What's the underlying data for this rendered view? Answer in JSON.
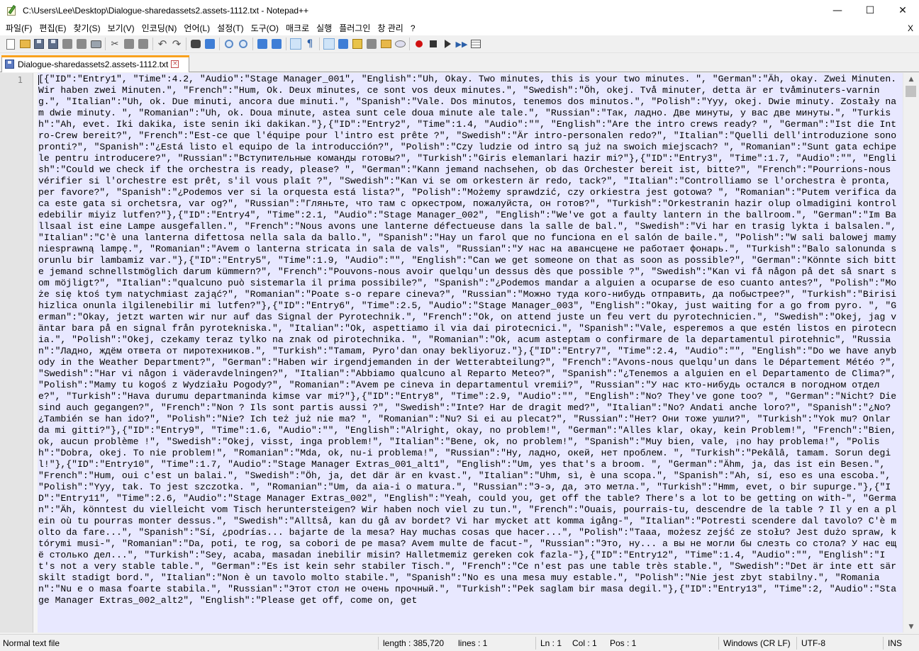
{
  "window": {
    "title": "C:\\Users\\Lee\\Desktop\\Dialogue-sharedassets2.assets-1112.txt - Notepad++",
    "minimize": "—",
    "maximize": "☐",
    "close": "✕"
  },
  "menu": {
    "items": [
      "파일(F)",
      "편집(E)",
      "찾기(S)",
      "보기(V)",
      "인코딩(N)",
      "언어(L)",
      "설정(T)",
      "도구(O)",
      "매크로",
      "실행",
      "플러그인",
      "창 관리",
      "?"
    ],
    "close_doc": "X"
  },
  "toolbar": {
    "icons": [
      "new-file-icon",
      "open-file-icon",
      "save-icon",
      "save-all-icon",
      "close-icon",
      "close-all-icon",
      "print-icon",
      "cut-icon",
      "copy-icon",
      "paste-icon",
      "undo-icon",
      "redo-icon",
      "find-icon",
      "replace-icon",
      "zoom-in-icon",
      "zoom-out-icon",
      "sync-vertical-icon",
      "sync-horizontal-icon",
      "word-wrap-icon",
      "show-all-chars-icon",
      "indent-guide-icon",
      "language-icon",
      "color-icon",
      "doc-map-icon",
      "folder-workspace-icon",
      "monitoring-icon",
      "record-macro-icon",
      "stop-record-icon",
      "play-macro-icon",
      "run-macro-multiple-icon",
      "save-macro-icon"
    ]
  },
  "tab": {
    "label": "Dialogue-sharedassets2.assets-1112.txt",
    "close": "×"
  },
  "editor": {
    "line_number": "1",
    "content": "[{\"ID\":\"Entry1\", \"Time\":4.2, \"Audio\":\"Stage Manager_001\", \"English\":\"Uh, Okay. Two minutes, this is your two minutes. \", \"German\":\"Äh, okay. Zwei Minuten. Wir haben zwei Minuten.\", \"French\":\"Hum, Ok. Deux minutes, ce sont vos deux minutes.\", \"Swedish\":\"Öh, okej. Två minuter, detta är er tvåminuters-varning.\", \"Italian\":\"Uh, ok. Due minuti, ancora due minuti.\", \"Spanish\":\"Vale. Dos minutos, tenemos dos minutos.\", \"Polish\":\"Yyy, okej. Dwie minuty. Zostały nam dwie minuty. \", \"Romanian\":\"Uh, ok. Doua minute, astea sunt cele doua minute ale tale.\", \"Russian\":\"Так, ладно. Две минуты, у вас две минуты.\", \"Turkish\":\"Ah, evet. Iki dakika, iste senin iki dakikan.\"},{\"ID\":\"Entry2\", \"Time\":1.4, \"Audio\":\"\", \"English\":\"Are the intro crews ready? \", \"German\":\"Ist die Intro-Crew bereit?\", \"French\":\"Est-ce que l'équipe pour l'intro est prête ?\", \"Swedish\":\"Är intro-personalen redo?\", \"Italian\":\"Quelli dell'introduzione sono pronti?\", \"Spanish\":\"¿Está listo el equipo de la introducción?\", \"Polish\":\"Czy ludzie od intro są już na swoich miejscach? \", \"Romanian\":\"Sunt gata echipele pentru introducere?\", \"Russian\":\"Вступительные команды готовы?\", \"Turkish\":\"Giris elemanlari hazir mi?\"},{\"ID\":\"Entry3\", \"Time\":1.7, \"Audio\":\"\", \"English\":\"Could we check if the orchestra is ready, please? \", \"German\":\"Kann jemand nachsehen, ob das Orchester bereit ist, bitte?\", \"French\":\"Pourrions-nous vérifier si l'orchestre est prêt, s'il vous plaît ?\", \"Swedish\":\"Kan vi se om orkestern är redo, tack?\", \"Italian\":\"Controlliamo se l'orchestra è pronta, per favore?\", \"Spanish\":\"¿Podemos ver si la orquesta está lista?\", \"Polish\":\"Możemy sprawdzić, czy orkiestra jest gotowa? \", \"Romanian\":\"Putem verifica daca este gata si orchetsra, var og?\", \"Russian\":\"Гляньте, что там с оркестром, пожалуйста, он готов?\", \"Turkish\":\"Orkestranin hazir olup olmadigini kontrol edebilir miyiz lutfen?\"},{\"ID\":\"Entry4\", \"Time\":2.1, \"Audio\":\"Stage Manager_002\", \"English\":\"We've got a faulty lantern in the ballroom.\", \"German\":\"Im Ballsaal ist eine Lampe ausgefallen.\", \"French\":\"Nous avons une lanterne défectueuse dans la salle de bal.\", \"Swedish\":\"Vi har en trasig lykta i balsalen.\", \"Italian\":\"C'è una lanterna difettosa nella sala da ballo.\", \"Spanish\":\"Hay un farol que no funciona en el salón de baile.\", \"Polish\":\"W sali balowej mamy niesprawną lampę.\", \"Romanian\":\"Avem o lanterna stricata in sala de vals\", \"Russian\":\"У нас на авансцене не работает фонарь.\", \"Turkish\":\"Balo salonunda sorunlu bir lambamiz var.\"},{\"ID\":\"Entry5\", \"Time\":1.9, \"Audio\":\"\", \"English\":\"Can we get someone on that as soon as possible?\", \"German\":\"Könnte sich bitte jemand schnellstmöglich darum kümmern?\", \"French\":\"Pouvons-nous avoir quelqu'un dessus dès que possible ?\", \"Swedish\":\"Kan vi få någon på det så snart som möjligt?\", \"Italian\":\"qualcuno può sistemarla il prima possibile?\", \"Spanish\":\"¿Podemos mandar a alguien a ocuparse de eso cuanto antes?\", \"Polish\":\"Może się ktoś tym natychmiast zająć?\", \"Romanian\":\"Poate s-o repare cineva?\", \"Russian\":\"Можно туда кого-нибудь отправить, да побыстрее?\", \"Turkish\":\"Birisi hizlica onunla ilgilenebilir mi lutfen?\"},{\"ID\":\"Entry6\", \"Time\":2.5, \"Audio\":\"Stage Manager_003\", \"English\":\"Okay, just waiting for a go from pyro. \", \"German\":\"Okay, jetzt warten wir nur auf das Signal der Pyrotechnik.\", \"French\":\"Ok, on attend juste un feu vert du pyrotechnicien.\", \"Swedish\":\"Okej, jag väntar bara på en signal från pyrotekniska.\", \"Italian\":\"Ok, aspettiamo il via dai pirotecnici.\", \"Spanish\":\"Vale, esperemos a que estén listos en pirotecnia.\", \"Polish\":\"Okej, czekamy teraz tylko na znak od pirotechnika. \", \"Romanian\":\"Ok, acum asteptam o confirmare de la departamentul pirotehnic\", \"Russian\":\"Ладно, ждём ответа от пиротехников.\", \"Turkish\":\"Tamam, Pyro'dan onay bekliyoruz.\"},{\"ID\":\"Entry7\", \"Time\":2.4, \"Audio\":\"\", \"English\":\"Do we have anybody in the Weather Department?\", \"German\":\"Haben wir irgendjemanden in der Wetterabteilung?\", \"French\":\"Avons-nous quelqu'un dans le Département Météo ?\", \"Swedish\":\"Har vi någon i väderavdelningen?\", \"Italian\":\"Abbiamo qualcuno al Reparto Meteo?\", \"Spanish\":\"¿Tenemos a alguien en el Departamento de Clima?\", \"Polish\":\"Mamy tu kogoś z Wydziału Pogody?\", \"Romanian\":\"Avem pe cineva in departamentul vremii?\", \"Russian\":\"У нас кто-нибудь остался в погодном отделе?\", \"Turkish\":\"Hava durumu departmaninda kimse var mi?\"},{\"ID\":\"Entry8\", \"Time\":2.9, \"Audio\":\"\", \"English\":\"No? They've gone too? \", \"German\":\"Nicht? Die sind auch gegangen?\", \"French\":\"Non ? Ils sont partis aussi ?\", \"Swedish\":\"Inte? Har de dragit med?\", \"Italian\":\"No? Andati anche loro?\", \"Spanish\":\"¿No? ¿También se han ido?\", \"Polish\":\"Nie? Ich też już nie ma? \", \"Romanian\":\"Nu? Si ei au plecat?\", \"Russian\":\"Нет? Они тоже ушли?\", \"Turkish\":\"Yok mu? Onlar da mi gitti?\"},{\"ID\":\"Entry9\", \"Time\":1.6, \"Audio\":\"\", \"English\":\"Alright, okay, no problem!\", \"German\":\"Alles klar, okay, kein Problem!\", \"French\":\"Bien, ok, aucun problème !\", \"Swedish\":\"Okej, visst, inga problem!\", \"Italian\":\"Bene, ok, no problem!\", \"Spanish\":\"Muy bien, vale, ¡no hay problema!\", \"Polish\":\"Dobra, okej. To nie problem!\", \"Romanian\":\"Mda, ok, nu-i problema!\", \"Russian\":\"Ну, ладно, окей, нет проблем. \", \"Turkish\":\"Pekâlâ, tamam. Sorun degil!\"},{\"ID\":\"Entry10\", \"Time\":1.7, \"Audio\":\"Stage Manager Extras_001_alt1\", \"English\":\"Um, yes that's a broom. \", \"German\":\"Ähm, ja, das ist ein Besen.\", \"French\":\"Hum, oui c'est un balai.\", \"Swedish\":\"Öh, ja, det där är en kvast.\", \"Italian\":\"Uhm, sì, è una scopa.\", \"Spanish\":\"Ah, sí, eso es una escoba.\", \"Polish\":\"Yyy, tak. To jest szczotka. \", \"Romanian\":\"Um, da aia-i o matura.\", \"Russian\":\"Э-э, да, это метла.\", \"Turkish\":\"Hmm, evet, o bir supurge.\"},{\"ID\":\"Entry11\", \"Time\":2.6, \"Audio\":\"Stage Manager Extras_002\", \"English\":\"Yeah, could you, get off the table? There's a lot to be getting on with-\", \"German\":\"Äh, könntest du vielleicht vom Tisch heruntersteigen? Wir haben noch viel zu tun.\", \"French\":\"Ouais, pourrais-tu, descendre de la table ? Il y en a plein où tu pourras monter dessus.\", \"Swedish\":\"Alltså, kan du gå av bordet? Vi har mycket att komma igång-\", \"Italian\":\"Potresti scendere dal tavolo? C'è molto da fare...\", \"Spanish\":\"Sí, ¿podrías... bajarte de la mesa? Hay muchas cosas que hacer...\", \"Polish\":\"Taaa, możesz zejść ze stołu? Jest dużo spraw, którymi musi-\", \"Romanian\":\"Da, poti, te rog, sa cobori de pe masa? Avem multe de facut-\", \"Russian\":\"Это, ну... а вы не могли бы слезть со стола? У нас ещё столько дел...\", \"Turkish\":\"Sey, acaba, masadan inebilir misin? Halletmemiz gereken cok fazla-\"},{\"ID\":\"Entry12\", \"Time\":1.4, \"Audio\":\"\", \"English\":\"It's not a very stable table.\", \"German\":\"Es ist kein sehr stabiler Tisch.\", \"French\":\"Ce n'est pas une table très stable.\", \"Swedish\":\"Det är inte ett särskilt stadigt bord.\", \"Italian\":\"Non è un tavolo molto stabile.\", \"Spanish\":\"No es una mesa muy estable.\", \"Polish\":\"Nie jest zbyt stabilny.\", \"Romanian\":\"Nu e o masa foarte stabila.\", \"Russian\":\"Этот стол не очень прочный.\", \"Turkish\":\"Pek saglam bir masa degil.\"},{\"ID\":\"Entry13\", \"Time\":2, \"Audio\":\"Stage Manager Extras_002_alt2\", \"English\":\"Please get off, come on, get"
  },
  "status": {
    "file_type": "Normal text file",
    "length": "length : 385,720",
    "lines": "lines : 1",
    "ln": "Ln : 1",
    "col": "Col : 1",
    "pos": "Pos : 1",
    "eol": "Windows (CR LF)",
    "encoding": "UTF-8",
    "mode": "INS"
  }
}
